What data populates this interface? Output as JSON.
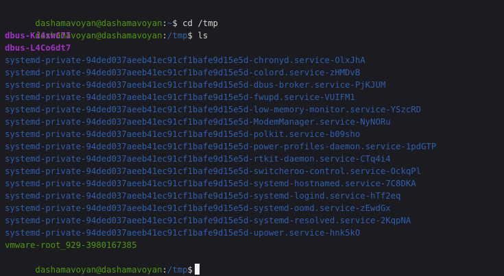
{
  "terminal": {
    "prompt": {
      "user_host": "dashamavoyan@dashamavoyan",
      "separator": ":"
    },
    "history": [
      {
        "path": "~",
        "command": "cd /tmp"
      },
      {
        "path": "/tmp",
        "command": "ls"
      }
    ],
    "output": {
      "dbus": [
        "dbus-Ki4xwC7I",
        "dbus-L4Co6dt7"
      ],
      "systemd": [
        "systemd-private-94ded037aeeb41ec91cf1bafe9d15e5d-chronyd.service-OlxJhA",
        "systemd-private-94ded037aeeb41ec91cf1bafe9d15e5d-colord.service-zHMDvB",
        "systemd-private-94ded037aeeb41ec91cf1bafe9d15e5d-dbus-broker.service-PjKJUM",
        "systemd-private-94ded037aeeb41ec91cf1bafe9d15e5d-fwupd.service-VUIFM1",
        "systemd-private-94ded037aeeb41ec91cf1bafe9d15e5d-low-memory-monitor.service-YSzcRD",
        "systemd-private-94ded037aeeb41ec91cf1bafe9d15e5d-ModemManager.service-NyNORu",
        "systemd-private-94ded037aeeb41ec91cf1bafe9d15e5d-polkit.service-b09sho",
        "systemd-private-94ded037aeeb41ec91cf1bafe9d15e5d-power-profiles-daemon.service-1pdGTP",
        "systemd-private-94ded037aeeb41ec91cf1bafe9d15e5d-rtkit-daemon.service-CTq4i4",
        "systemd-private-94ded037aeeb41ec91cf1bafe9d15e5d-switcheroo-control.service-OckqPl",
        "systemd-private-94ded037aeeb41ec91cf1bafe9d15e5d-systemd-hostnamed.service-7C8DKA",
        "systemd-private-94ded037aeeb41ec91cf1bafe9d15e5d-systemd-logind.service-hTf2eq",
        "systemd-private-94ded037aeeb41ec91cf1bafe9d15e5d-systemd-oomd.service-zEwdGx",
        "systemd-private-94ded037aeeb41ec91cf1bafe9d15e5d-systemd-resolved.service-2KqpNA",
        "systemd-private-94ded037aeeb41ec91cf1bafe9d15e5d-upower.service-hnk5kO"
      ],
      "vmware": "vmware-root_929-3980167385"
    },
    "current_prompt": {
      "path": "/tmp"
    },
    "colors": {
      "background": "#1b1b20",
      "user_host": "#4e9a06",
      "path": "#3465a4",
      "directory": "#2f5fb0",
      "dbus_entry": "#a033c4"
    }
  }
}
